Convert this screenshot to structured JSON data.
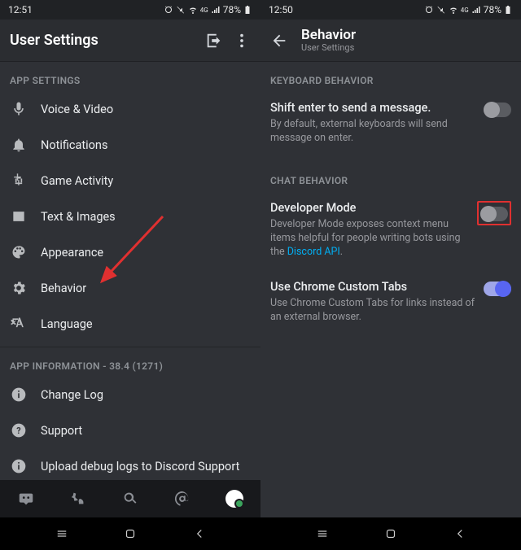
{
  "left": {
    "status": {
      "time": "12:51",
      "battery": "78%"
    },
    "title": "User Settings",
    "sections": {
      "appSettingsHdr": "APP SETTINGS",
      "rows": {
        "voice": "Voice & Video",
        "notifications": "Notifications",
        "gameActivity": "Game Activity",
        "textImages": "Text & Images",
        "appearance": "Appearance",
        "behavior": "Behavior",
        "language": "Language"
      },
      "appInfoHdr": "APP INFORMATION - 38.4 (1271)",
      "infoRows": {
        "changelog": "Change Log",
        "support": "Support",
        "upload": "Upload debug logs to Discord Support"
      }
    }
  },
  "right": {
    "status": {
      "time": "12:50",
      "battery": "78%"
    },
    "title": "Behavior",
    "subtitle": "User Settings",
    "sections": {
      "kbHdr": "KEYBOARD BEHAVIOR",
      "shift": {
        "title": "Shift enter to send a message.",
        "desc": "By default, external keyboards will send message on enter."
      },
      "chatHdr": "CHAT BEHAVIOR",
      "dev": {
        "title": "Developer Mode",
        "descA": "Developer Mode exposes context menu items helpful for people writing bots using the ",
        "link": "Discord API",
        "descB": "."
      },
      "chrome": {
        "title": "Use Chrome Custom Tabs",
        "desc": "Use Chrome Custom Tabs for links instead of an external browser."
      }
    }
  }
}
